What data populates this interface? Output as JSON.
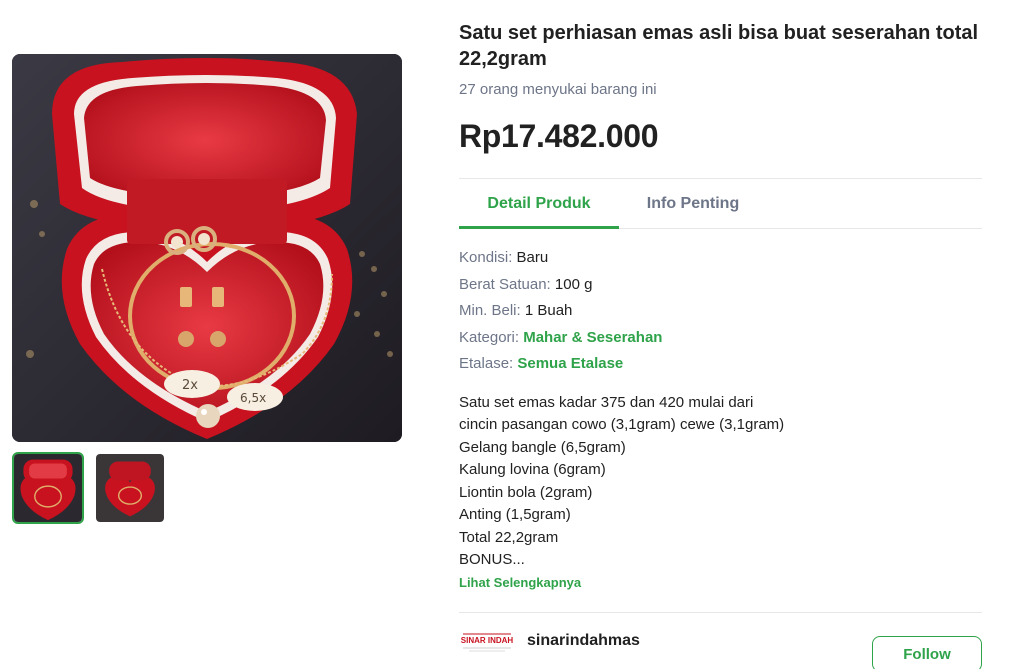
{
  "product": {
    "title": "Satu set perhiasan emas asli bisa buat seserahan total 22,2gram",
    "likes": "27 orang menyukai barang ini",
    "price": "Rp17.482.000",
    "image_alt": "Red heart-shaped jewelry box with gold necklace, bangle, earrings and rings"
  },
  "tabs": [
    {
      "label": "Detail Produk"
    },
    {
      "label": "Info Penting"
    }
  ],
  "specs": {
    "condition_key": "Kondisi:",
    "condition_value": "Baru",
    "weight_key": "Berat Satuan:",
    "weight_value": "100 g",
    "min_key": "Min. Beli:",
    "min_value": "1 Buah",
    "category_key": "Kategori:",
    "category_value": "Mahar & Seserahan",
    "etalase_key": "Etalase:",
    "etalase_value": "Semua Etalase"
  },
  "description": [
    "Satu set emas kadar 375 dan 420 mulai dari",
    "cincin pasangan cowo (3,1gram) cewe (3,1gram)",
    "Gelang bangle (6,5gram)",
    "Kalung lovina (6gram)",
    "Liontin bola (2gram)",
    "Anting (1,5gram)",
    "Total 22,2gram",
    "BONUS..."
  ],
  "see_more": "Lihat Selengkapnya",
  "shop": {
    "name": "sinarindahmas",
    "logo_text": "SINAR INDAH",
    "follow_label": "Follow"
  },
  "image_labels": {
    "tag1": "2x",
    "tag2": "6,5x"
  },
  "colors": {
    "accent": "#2fa34a",
    "box_red": "#d81f2c",
    "gold": "#d9a05b"
  }
}
